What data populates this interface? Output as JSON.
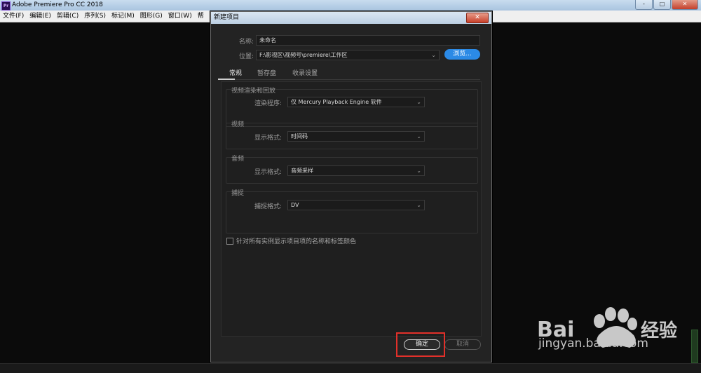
{
  "app": {
    "logo_text": "Pr",
    "title": "Adobe Premiere Pro CC 2018",
    "menu": [
      "文件(F)",
      "编辑(E)",
      "剪辑(C)",
      "序列(S)",
      "标记(M)",
      "图形(G)",
      "窗口(W)",
      "帮"
    ],
    "window_controls": {
      "minimize": "-",
      "maximize": "□",
      "close": "✕"
    }
  },
  "dialog": {
    "title": "新建项目",
    "close_label": "✕",
    "name_label": "名称:",
    "name_value": "未命名",
    "location_label": "位置:",
    "location_value": "F:\\影视区\\视频号\\premiere\\工作区",
    "browse_label": "浏览...",
    "tabs": [
      "常规",
      "暂存盘",
      "收录设置"
    ],
    "active_tab": "常规",
    "groups": {
      "render": {
        "title": "视频渲染和回放",
        "field_label": "渲染程序:",
        "value": "仅 Mercury Playback Engine 软件"
      },
      "video": {
        "title": "视频",
        "field_label": "显示格式:",
        "value": "时间码"
      },
      "audio": {
        "title": "音频",
        "field_label": "显示格式:",
        "value": "音频采样"
      },
      "capture": {
        "title": "捕捉",
        "field_label": "捕捉格式:",
        "value": "DV"
      }
    },
    "checkbox_label": "针对所有实例显示项目项的名称和标签颜色",
    "checkbox_checked": false,
    "ok_label": "确定",
    "cancel_label": "取消"
  },
  "watermark": {
    "logo_text": "Bai",
    "logo_cn": "经验",
    "url": "jingyan.baidu.com"
  },
  "colors": {
    "accent": "#2b8ae6",
    "highlight": "#e2302a",
    "dialog_bg": "#232323"
  }
}
